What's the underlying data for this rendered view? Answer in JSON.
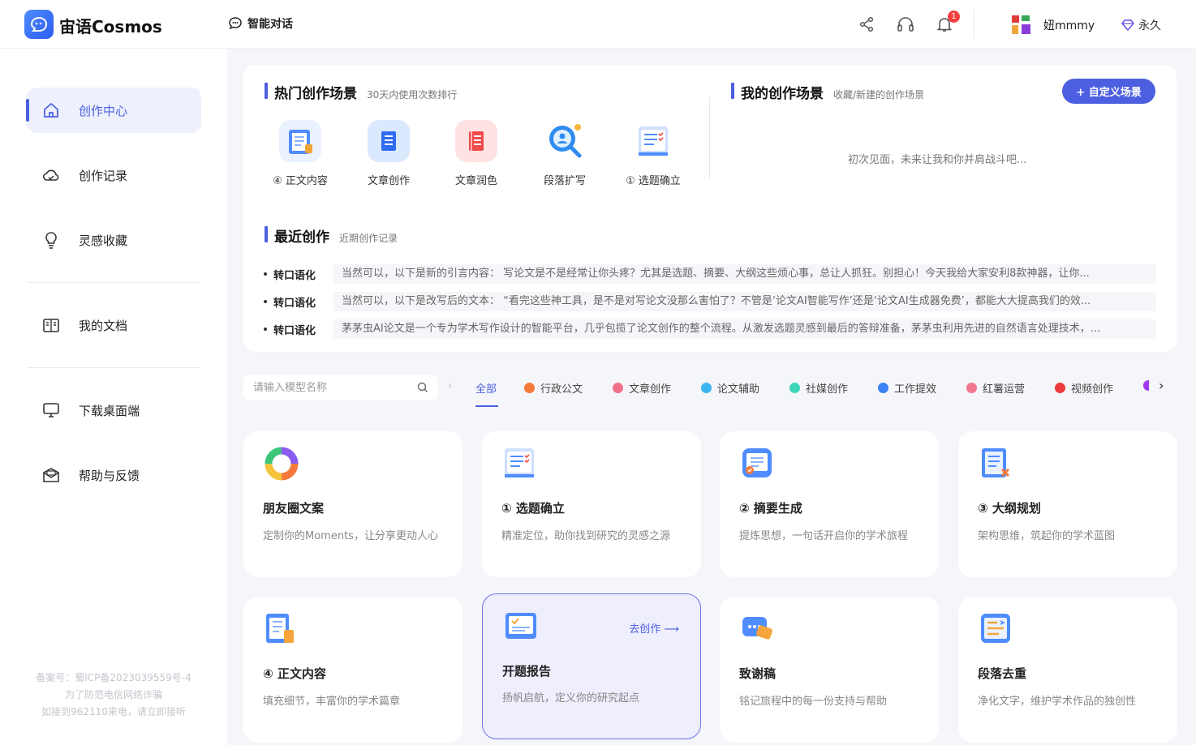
{
  "header": {
    "brand": "宙语Cosmos",
    "chat_label": "智能对话",
    "notif_count": "1",
    "username": "妞mmmy",
    "vip_label": "永久"
  },
  "sidebar": {
    "items": [
      {
        "label": "创作中心",
        "icon": "home-icon"
      },
      {
        "label": "创作记录",
        "icon": "cloud-icon"
      },
      {
        "label": "灵感收藏",
        "icon": "bulb-icon"
      },
      {
        "label": "我的文档",
        "icon": "book-icon"
      },
      {
        "label": "下载桌面端",
        "icon": "monitor-icon"
      },
      {
        "label": "帮助与反馈",
        "icon": "mail-icon"
      }
    ],
    "footer": [
      "备案号：蜀ICP备2023039559号-4",
      "为了防范电信网络诈骗",
      "如接到962110来电，请立即接听"
    ]
  },
  "hot": {
    "title": "热门创作场景",
    "subtitle": "30天内使用次数排行",
    "scenes": [
      "④ 正文内容",
      "文章创作",
      "文章润色",
      "段落扩写",
      "① 选题确立"
    ]
  },
  "mine": {
    "title": "我的创作场景",
    "subtitle": "收藏/新建的创作场景",
    "button": "+ 自定义场景",
    "empty": "初次见面，未来让我和你并肩战斗吧..."
  },
  "recent": {
    "title": "最近创作",
    "subtitle": "近期创作记录",
    "items": [
      {
        "tag": "转口语化",
        "text": "当然可以，以下是新的引言内容： 写论文是不是经常让你头疼？尤其是选题、摘要、大纲这些烦心事，总让人抓狂。别担心！今天我给大家安利8款神器，让你..."
      },
      {
        "tag": "转口语化",
        "text": "当然可以，以下是改写后的文本： “看完这些神工具，是不是对写论文没那么害怕了？不管是‘论文AI智能写作’还是‘论文AI生成器免费’，都能大大提高我们的效..."
      },
      {
        "tag": "转口语化",
        "text": "茅茅虫AI论文是一个专为学术写作设计的智能平台，几乎包揽了论文创作的整个流程。从激发选题灵感到最后的答辩准备，茅茅虫利用先进的自然语言处理技术，..."
      }
    ]
  },
  "filter": {
    "search_placeholder": "请输入模型名称",
    "categories": [
      {
        "label": "全部",
        "color": ""
      },
      {
        "label": "行政公文",
        "color": "#f5793b"
      },
      {
        "label": "文章创作",
        "color": "#f0708a"
      },
      {
        "label": "论文辅助",
        "color": "#3db5f0"
      },
      {
        "label": "社媒创作",
        "color": "#3dd5b8"
      },
      {
        "label": "工作提效",
        "color": "#3b82f6"
      },
      {
        "label": "红薯运营",
        "color": "#f07890"
      },
      {
        "label": "视频创作",
        "color": "#ef3b3b"
      }
    ]
  },
  "cards": [
    {
      "title": "朋友圈文案",
      "desc": "定制你的Moments，让分享更动人心",
      "icon": "ring-icon"
    },
    {
      "title": "① 选题确立",
      "desc": "精准定位，助你找到研究的灵感之源",
      "icon": "checklist-icon"
    },
    {
      "title": "② 摘要生成",
      "desc": "提炼思想，一句话开启你的学术旅程",
      "icon": "document-icon"
    },
    {
      "title": "③ 大纲规划",
      "desc": "架构思维，筑起你的学术蓝图",
      "icon": "outline-icon"
    },
    {
      "title": "④ 正文内容",
      "desc": "填充细节，丰富你的学术篇章",
      "icon": "clipboard-icon"
    },
    {
      "title": "开题报告",
      "desc": "扬帆启航，定义你的研究起点",
      "icon": "report-icon",
      "action": "去创作 ⟶"
    },
    {
      "title": "致谢稿",
      "desc": "铭记旅程中的每一份支持与帮助",
      "icon": "chat-card-icon"
    },
    {
      "title": "段落去重",
      "desc": "净化文字，维护学术作品的独创性",
      "icon": "dedupe-icon"
    }
  ],
  "colors": {
    "accent": "#4b5fe0"
  }
}
